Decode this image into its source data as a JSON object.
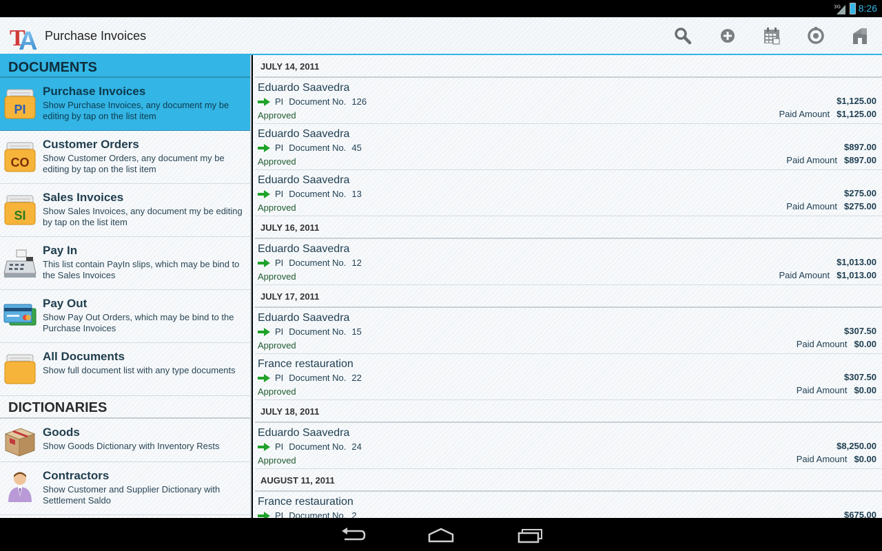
{
  "status_bar": {
    "network": "3G",
    "time": "8:26"
  },
  "action_bar": {
    "logo_text": "TA",
    "title": "Purchase Invoices",
    "icons": [
      "search-icon",
      "add-icon",
      "calendar-icon",
      "sync-icon",
      "home-icon"
    ]
  },
  "sidebar": {
    "documents_header": "DOCUMENTS",
    "dictionaries_header": "DICTIONARIES",
    "documents": [
      {
        "badge": "PI",
        "title": "Purchase Invoices",
        "desc": "Show Purchase Invoices, any document my be editing by tap on the list item",
        "selected": true
      },
      {
        "badge": "CO",
        "title": "Customer Orders",
        "desc": "Show Customer Orders, any document my be editing by tap on the list item"
      },
      {
        "badge": "SI",
        "title": "Sales Invoices",
        "desc": "Show Sales Invoices, any document my be editing by tap on the list item"
      },
      {
        "title": "Pay In",
        "desc": "This list contain PayIn slips, which may be bind to the Sales Invoices",
        "icon": "cash-register-icon"
      },
      {
        "title": "Pay Out",
        "desc": "Show Pay Out Orders, which may be bind to the Purchase Invoices",
        "icon": "credit-card-icon"
      },
      {
        "title": "All Documents",
        "desc": "Show full document list with any type documents",
        "icon": "folder-icon"
      }
    ],
    "dictionaries": [
      {
        "title": "Goods",
        "desc": "Show Goods Dictionary with Inventory Rests",
        "icon": "box-icon"
      },
      {
        "title": "Contractors",
        "desc": "Show Customer and Supplier Dictionary with Settlement Saldo",
        "icon": "person-icon"
      }
    ]
  },
  "main": {
    "doc_label": "Document No.",
    "paid_label": "Paid Amount",
    "groups": [
      {
        "date": "JULY 14, 2011",
        "rows": [
          {
            "party": "Eduardo Saavedra",
            "type": "PI",
            "number": "126",
            "status": "Approved",
            "amount": "$1,125.00",
            "paid": "$1,125.00"
          },
          {
            "party": "Eduardo Saavedra",
            "type": "PI",
            "number": "45",
            "status": "Approved",
            "amount": "$897.00",
            "paid": "$897.00"
          },
          {
            "party": "Eduardo Saavedra",
            "type": "PI",
            "number": "13",
            "status": "Approved",
            "amount": "$275.00",
            "paid": "$275.00"
          }
        ]
      },
      {
        "date": "JULY 16, 2011",
        "rows": [
          {
            "party": "Eduardo Saavedra",
            "type": "PI",
            "number": "12",
            "status": "Approved",
            "amount": "$1,013.00",
            "paid": "$1,013.00"
          }
        ]
      },
      {
        "date": "JULY 17, 2011",
        "rows": [
          {
            "party": "Eduardo Saavedra",
            "type": "PI",
            "number": "15",
            "status": "Approved",
            "amount": "$307.50",
            "paid": "$0.00"
          },
          {
            "party": "France restauration",
            "type": "PI",
            "number": "22",
            "status": "Approved",
            "amount": "$307.50",
            "paid": "$0.00"
          }
        ]
      },
      {
        "date": "JULY 18, 2011",
        "rows": [
          {
            "party": "Eduardo Saavedra",
            "type": "PI",
            "number": "24",
            "status": "Approved",
            "amount": "$8,250.00",
            "paid": "$0.00"
          }
        ]
      },
      {
        "date": "AUGUST 11, 2011",
        "rows": [
          {
            "party": "France restauration",
            "type": "PI",
            "number": "2",
            "status": "",
            "amount": "$675.00",
            "paid": ""
          }
        ]
      }
    ]
  },
  "nav_bar": {
    "buttons": [
      "back-icon",
      "home-nav-icon",
      "recent-apps-icon"
    ]
  },
  "colors": {
    "accent": "#33b5e5",
    "status_green": "#1f5b30",
    "arrow_green": "#1fa32b"
  }
}
